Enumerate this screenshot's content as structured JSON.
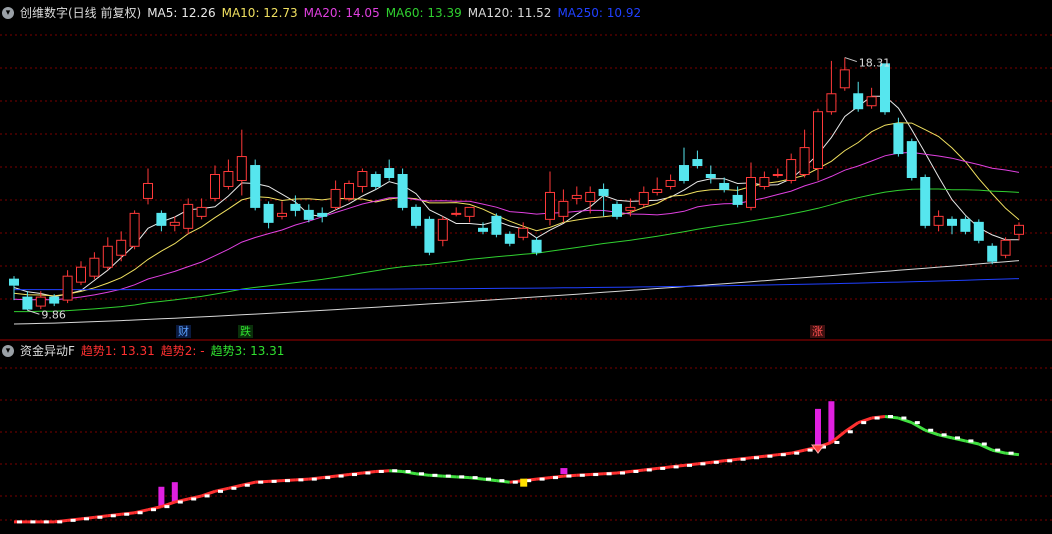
{
  "main_panel": {
    "title": "创维数字(日线 前复权)",
    "ma_labels": [
      {
        "text": "MA5: 12.26",
        "color": "#e8e8e8"
      },
      {
        "text": "MA10: 12.73",
        "color": "#f0e060"
      },
      {
        "text": "MA20: 14.05",
        "color": "#e040e0"
      },
      {
        "text": "MA60: 13.39",
        "color": "#30d030"
      },
      {
        "text": "MA120: 11.52",
        "color": "#d8d8d8"
      },
      {
        "text": "MA250: 10.92",
        "color": "#2040ff"
      }
    ],
    "high_marker": "18.31",
    "low_marker": "9.86",
    "events": [
      {
        "text": "财",
        "color": "#5aa0ff",
        "bg": "#0a1a40"
      },
      {
        "text": "跌",
        "color": "#30e030",
        "bg": "#0a300a"
      },
      {
        "text": "涨",
        "color": "#ff5050",
        "bg": "#401010"
      }
    ]
  },
  "indicator_panel": {
    "title": "资金异动F",
    "labels": [
      {
        "text": "趋势1: 13.31",
        "color": "#ff3030"
      },
      {
        "text": "趋势2: -",
        "color": "#ff3030"
      },
      {
        "text": "趋势3: 13.31",
        "color": "#30e030"
      }
    ]
  },
  "colors": {
    "up": "#ff3a3a",
    "down": "#56e6ee",
    "grid": "#7a0000",
    "background": "#000000"
  },
  "chart_data": [
    {
      "type": "candlestick",
      "title": "创维数字(日线 前复权)",
      "ylim": [
        9.2,
        19.5
      ],
      "grid": true,
      "high": 18.31,
      "low": 9.86,
      "ohlc": [
        [
          10.9,
          10.7,
          10.2,
          11.0
        ],
        [
          10.3,
          9.9,
          9.86,
          10.5
        ],
        [
          10.0,
          10.3,
          9.9,
          10.5
        ],
        [
          10.3,
          10.1,
          10.0,
          10.4
        ],
        [
          10.2,
          11.0,
          10.1,
          11.2
        ],
        [
          10.8,
          11.3,
          10.7,
          11.5
        ],
        [
          11.0,
          11.6,
          10.9,
          11.8
        ],
        [
          11.3,
          12.0,
          11.2,
          12.3
        ],
        [
          11.7,
          12.2,
          11.5,
          12.5
        ],
        [
          12.0,
          13.1,
          11.9,
          13.2
        ],
        [
          13.6,
          14.1,
          13.4,
          14.6
        ],
        [
          13.1,
          12.7,
          12.5,
          13.2
        ],
        [
          12.7,
          12.8,
          12.5,
          13.0
        ],
        [
          12.6,
          13.4,
          12.4,
          13.6
        ],
        [
          13.0,
          13.3,
          12.9,
          13.6
        ],
        [
          13.6,
          14.4,
          13.5,
          14.7
        ],
        [
          14.0,
          14.5,
          13.9,
          14.9
        ],
        [
          14.2,
          15.0,
          13.7,
          15.9
        ],
        [
          14.7,
          13.3,
          13.2,
          14.9
        ],
        [
          13.4,
          12.8,
          12.6,
          13.5
        ],
        [
          13.0,
          13.1,
          12.9,
          13.5
        ],
        [
          13.4,
          13.2,
          13.0,
          13.7
        ],
        [
          13.2,
          12.9,
          12.8,
          13.4
        ],
        [
          13.1,
          13.0,
          12.8,
          13.3
        ],
        [
          13.3,
          13.9,
          13.2,
          14.2
        ],
        [
          13.6,
          14.1,
          13.5,
          14.2
        ],
        [
          14.0,
          14.5,
          13.8,
          14.6
        ],
        [
          14.4,
          14.0,
          13.9,
          14.5
        ],
        [
          14.6,
          14.3,
          14.2,
          14.9
        ],
        [
          14.4,
          13.3,
          13.2,
          14.6
        ],
        [
          13.3,
          12.7,
          12.6,
          13.4
        ],
        [
          12.9,
          11.8,
          11.7,
          13.0
        ],
        [
          12.2,
          12.9,
          12.0,
          13.0
        ],
        [
          13.1,
          13.1,
          13.0,
          13.3
        ],
        [
          13.0,
          13.3,
          12.8,
          13.3
        ],
        [
          12.6,
          12.5,
          12.4,
          12.8
        ],
        [
          13.0,
          12.4,
          12.3,
          13.1
        ],
        [
          12.4,
          12.1,
          12.0,
          12.5
        ],
        [
          12.3,
          12.6,
          12.2,
          12.8
        ],
        [
          12.2,
          11.8,
          11.7,
          12.3
        ],
        [
          12.9,
          13.8,
          12.7,
          14.5
        ],
        [
          13.0,
          13.5,
          12.8,
          13.9
        ],
        [
          13.6,
          13.7,
          13.4,
          14.0
        ],
        [
          13.5,
          13.8,
          13.1,
          14.0
        ],
        [
          13.9,
          13.7,
          13.0,
          14.1
        ],
        [
          13.4,
          13.0,
          12.9,
          13.5
        ],
        [
          13.2,
          13.3,
          13.0,
          13.6
        ],
        [
          13.4,
          13.8,
          13.3,
          14.0
        ],
        [
          13.8,
          13.9,
          13.7,
          14.3
        ],
        [
          14.0,
          14.2,
          13.9,
          14.4
        ],
        [
          14.7,
          14.2,
          14.1,
          15.3
        ],
        [
          14.9,
          14.7,
          14.6,
          15.2
        ],
        [
          14.4,
          14.3,
          14.1,
          14.7
        ],
        [
          14.1,
          13.9,
          13.8,
          14.3
        ],
        [
          13.7,
          13.4,
          13.3,
          14.0
        ],
        [
          13.3,
          14.3,
          13.2,
          14.8
        ],
        [
          14.0,
          14.3,
          13.9,
          14.5
        ],
        [
          14.4,
          14.4,
          14.3,
          14.6
        ],
        [
          14.2,
          14.9,
          14.1,
          15.1
        ],
        [
          14.4,
          15.3,
          14.3,
          15.9
        ],
        [
          14.6,
          16.5,
          14.2,
          16.6
        ],
        [
          16.5,
          17.1,
          16.4,
          18.2
        ],
        [
          17.3,
          17.9,
          17.2,
          18.31
        ],
        [
          17.1,
          16.6,
          16.5,
          17.5
        ],
        [
          16.7,
          17.0,
          16.6,
          17.3
        ],
        [
          18.1,
          16.5,
          16.4,
          18.1
        ],
        [
          16.1,
          15.1,
          15.0,
          16.3
        ],
        [
          15.5,
          14.3,
          14.2,
          15.6
        ],
        [
          14.3,
          12.7,
          12.6,
          14.4
        ],
        [
          12.7,
          13.0,
          12.5,
          13.2
        ],
        [
          12.9,
          12.7,
          12.4,
          13.0
        ],
        [
          12.9,
          12.5,
          12.4,
          13.0
        ],
        [
          12.8,
          12.2,
          12.1,
          12.9
        ],
        [
          12.0,
          11.5,
          11.4,
          12.1
        ],
        [
          11.7,
          12.2,
          11.6,
          12.3
        ],
        [
          12.4,
          12.7,
          12.2,
          12.8
        ]
      ],
      "series": [
        {
          "name": "MA5",
          "end_value": 12.26
        },
        {
          "name": "MA10",
          "end_value": 12.73
        },
        {
          "name": "MA20",
          "end_value": 14.05
        },
        {
          "name": "MA60",
          "end_value": 13.39
        },
        {
          "name": "MA120",
          "end_value": 11.52
        },
        {
          "name": "MA250",
          "end_value": 10.92
        }
      ]
    },
    {
      "type": "line",
      "title": "资金异动F",
      "ylim": [
        9.0,
        20.0
      ],
      "series": [
        {
          "name": "趋势1",
          "values": [
            9.4,
            9.4,
            9.4,
            9.4,
            9.5,
            9.6,
            9.7,
            9.8,
            9.9,
            10.0,
            10.2,
            10.4,
            10.7,
            10.9,
            11.1,
            11.4,
            11.6,
            11.8,
            12.0,
            12.05,
            12.1,
            12.15,
            12.2,
            12.3,
            12.4,
            12.5,
            12.6,
            12.7,
            12.75,
            12.7,
            12.55,
            12.45,
            12.4,
            12.35,
            12.3,
            12.2,
            12.1,
            12.0,
            12.1,
            12.2,
            12.3,
            12.4,
            12.45,
            12.5,
            12.55,
            12.6,
            12.7,
            12.8,
            12.9,
            13.0,
            13.1,
            13.2,
            13.3,
            13.4,
            13.5,
            13.6,
            13.7,
            13.8,
            13.9,
            14.1,
            14.3,
            14.6,
            15.3,
            15.9,
            16.2,
            16.3,
            16.2,
            15.9,
            15.4,
            15.1,
            14.9,
            14.7,
            14.5,
            14.1,
            13.9,
            13.8
          ]
        },
        {
          "name": "趋势3",
          "end_value": 13.31
        }
      ],
      "signal_bars": [
        {
          "index": 11,
          "value": 11.7
        },
        {
          "index": 12,
          "value": 12.0
        },
        {
          "index": 60,
          "value": 16.8
        },
        {
          "index": 61,
          "value": 17.3
        }
      ]
    }
  ]
}
